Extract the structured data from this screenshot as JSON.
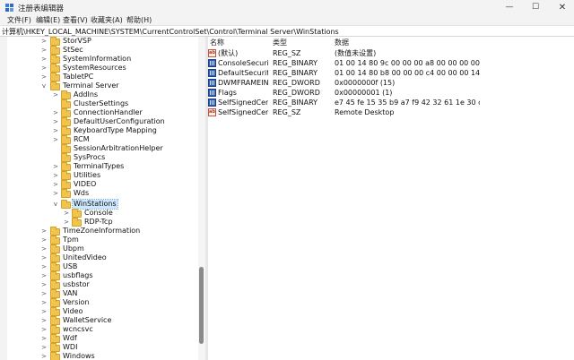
{
  "window": {
    "title": "注册表编辑器"
  },
  "menu": [
    "文件(F)",
    "编辑(E)",
    "查看(V)",
    "收藏夹(A)",
    "帮助(H)"
  ],
  "address": "计算机\\HKEY_LOCAL_MACHINE\\SYSTEM\\CurrentControlSet\\Control\\Terminal Server\\WinStations",
  "tree": {
    "items": [
      {
        "label": "StorVSP",
        "chevron": ">"
      },
      {
        "label": "StSec",
        "chevron": ">"
      },
      {
        "label": "SystemInformation",
        "chevron": ">"
      },
      {
        "label": "SystemResources",
        "chevron": ">"
      },
      {
        "label": "TabletPC",
        "chevron": ">"
      },
      {
        "label": "Terminal Server",
        "chevron": "v"
      },
      {
        "label": "AddIns",
        "chevron": ">"
      },
      {
        "label": "ClusterSettings",
        "chevron": ""
      },
      {
        "label": "ConnectionHandler",
        "chevron": ">"
      },
      {
        "label": "DefaultUserConfiguration",
        "chevron": ">"
      },
      {
        "label": "KeyboardType Mapping",
        "chevron": ">"
      },
      {
        "label": "RCM",
        "chevron": ">"
      },
      {
        "label": "SessionArbitrationHelper",
        "chevron": ""
      },
      {
        "label": "SysProcs",
        "chevron": ""
      },
      {
        "label": "TerminalTypes",
        "chevron": ">"
      },
      {
        "label": "Utilities",
        "chevron": ">"
      },
      {
        "label": "VIDEO",
        "chevron": ">"
      },
      {
        "label": "Wds",
        "chevron": ">"
      },
      {
        "label": "WinStations",
        "chevron": "v"
      },
      {
        "label": "Console",
        "chevron": ">"
      },
      {
        "label": "RDP-Tcp",
        "chevron": ">"
      },
      {
        "label": "TimeZoneInformation",
        "chevron": ">"
      },
      {
        "label": "Tpm",
        "chevron": ">"
      },
      {
        "label": "Ubpm",
        "chevron": ">"
      },
      {
        "label": "UnitedVideo",
        "chevron": ">"
      },
      {
        "label": "USB",
        "chevron": ">"
      },
      {
        "label": "usbflags",
        "chevron": ">"
      },
      {
        "label": "usbstor",
        "chevron": ">"
      },
      {
        "label": "VAN",
        "chevron": ">"
      },
      {
        "label": "Version",
        "chevron": ">"
      },
      {
        "label": "Video",
        "chevron": ">"
      },
      {
        "label": "WalletService",
        "chevron": ">"
      },
      {
        "label": "wcncsvc",
        "chevron": ">"
      },
      {
        "label": "Wdf",
        "chevron": ">"
      },
      {
        "label": "WDI",
        "chevron": ">"
      },
      {
        "label": "Windows",
        "chevron": ">"
      }
    ]
  },
  "list": {
    "columns": {
      "name": "名称",
      "type": "类型",
      "data": "数据"
    },
    "rows": [
      {
        "icon": "string-value-icon",
        "name": "(默认)",
        "type": "REG_SZ",
        "data": "(数值未设置)"
      },
      {
        "icon": "binary-value-icon",
        "name": "ConsoleSecurity",
        "type": "REG_BINARY",
        "data": "01 00 14 80 9c 00 00 00 a8 00 00 00 00 00 00 ..."
      },
      {
        "icon": "binary-value-icon",
        "name": "DefaultSecurity",
        "type": "REG_BINARY",
        "data": "01 00 14 80 b8 00 00 00 c4 00 00 00 14 00 00 ..."
      },
      {
        "icon": "binary-value-icon",
        "name": "DWMFRAMEIN...",
        "type": "REG_DWORD",
        "data": "0x0000000f (15)"
      },
      {
        "icon": "binary-value-icon",
        "name": "Flags",
        "type": "REG_DWORD",
        "data": "0x00000001 (1)"
      },
      {
        "icon": "binary-value-icon",
        "name": "SelfSignedCerti...",
        "type": "REG_BINARY",
        "data": "e7 45 fe 15 35 b9 a7 f9 42 32 61 1e 30 ce 4e 3..."
      },
      {
        "icon": "string-value-icon",
        "name": "SelfSignedCert...",
        "type": "REG_SZ",
        "data": "Remote Desktop"
      }
    ]
  }
}
